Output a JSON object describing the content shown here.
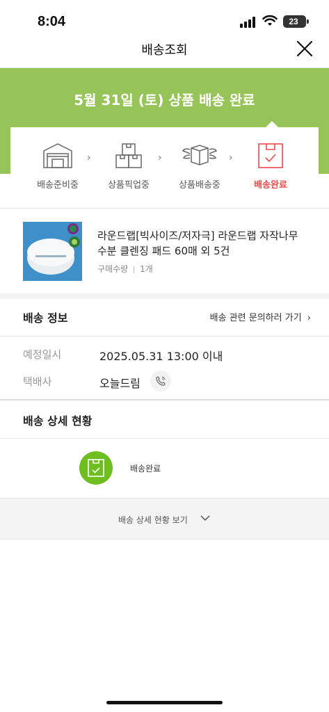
{
  "status_bar": {
    "time": "8:04",
    "battery": "23"
  },
  "header": {
    "title": "배송조회"
  },
  "banner": {
    "title": "5월 31일 (토) 상품 배송 완료"
  },
  "progress": {
    "steps": [
      {
        "label": "배송준비중",
        "icon": "warehouse-icon"
      },
      {
        "label": "상품픽업중",
        "icon": "boxes-icon"
      },
      {
        "label": "상품배송중",
        "icon": "winged-box-icon"
      },
      {
        "label": "배송완료",
        "icon": "box-check-icon",
        "active": true
      }
    ],
    "active_color": "#e94a4a"
  },
  "product": {
    "name": "라운드랩[빅사이즈/저자극] 라운드랩 자작나무 수분 클렌징 패드 60매 외 5건",
    "qty_label": "구매수량",
    "qty_value": "1개"
  },
  "delivery_info": {
    "section_title": "배송 정보",
    "inquiry_link": "배송 관련 문의하러 가기",
    "rows": [
      {
        "label": "예정일시",
        "value": "2025.05.31 13:00 이내"
      },
      {
        "label": "택배사",
        "value": "오늘드림"
      }
    ]
  },
  "tracking": {
    "section_title": "배송 상세 현황",
    "status": "배송완료",
    "more_label": "배송 상세 현황 보기"
  },
  "colors": {
    "banner": "#97c458",
    "track_icon": "#6fbe1f",
    "accent": "#e94a4a"
  }
}
